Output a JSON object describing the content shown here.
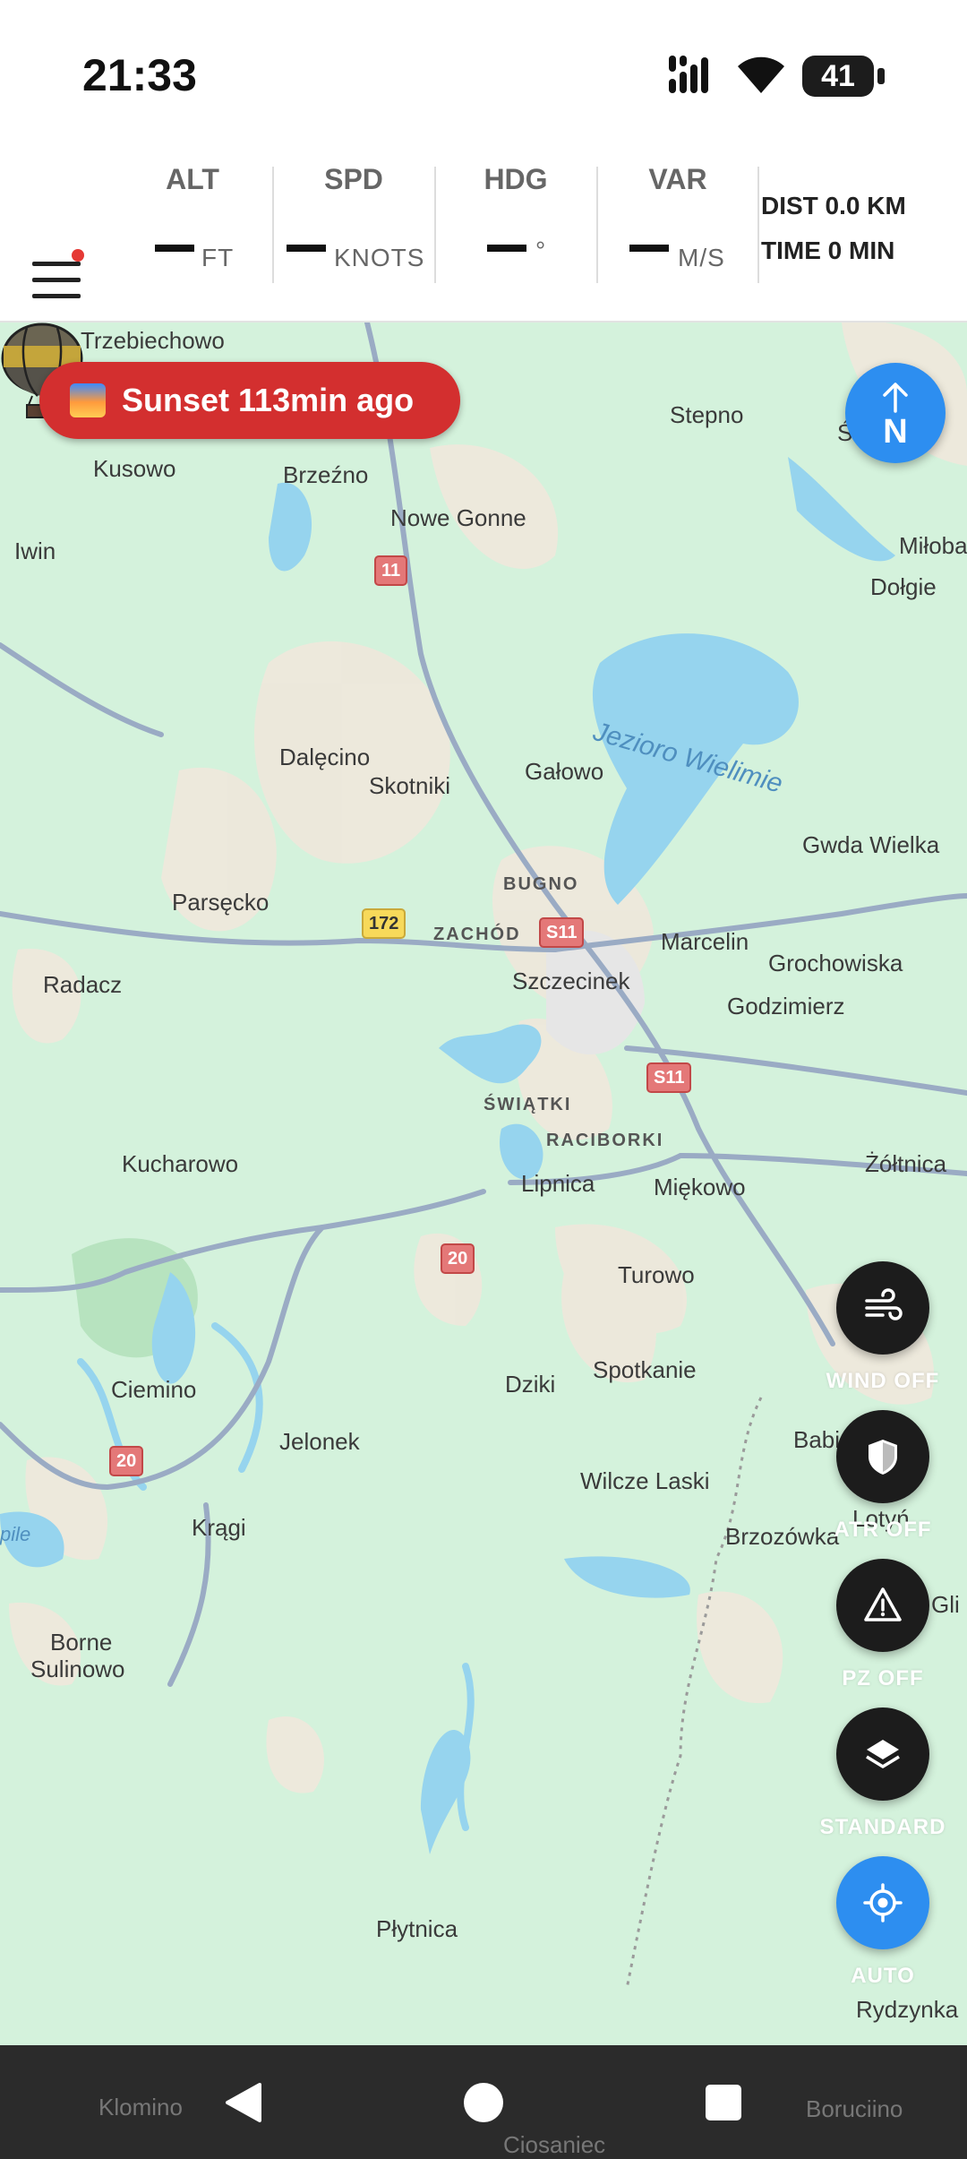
{
  "status_bar": {
    "time": "21:33",
    "battery": "41",
    "icons": [
      "signal-icon",
      "wifi-icon",
      "battery-icon"
    ]
  },
  "instruments": {
    "menu_icon": "hamburger-menu-icon",
    "gauges": [
      {
        "label": "ALT",
        "value": "—",
        "unit": "FT"
      },
      {
        "label": "SPD",
        "value": "—",
        "unit": "KNOTS"
      },
      {
        "label": "HDG",
        "value": "—",
        "unit": "°"
      },
      {
        "label": "VAR",
        "value": "—",
        "unit": "M/S"
      }
    ],
    "distance": "DIST 0.0 KM",
    "time": "TIME 0 MIN"
  },
  "sunset_badge": {
    "icon": "sunset-icon",
    "text": "Sunset 113min ago"
  },
  "compass": {
    "label": "N",
    "icon": "north-arrow-icon"
  },
  "map_controls": [
    {
      "icon": "wind-icon",
      "label": "WIND OFF"
    },
    {
      "icon": "shield-icon",
      "label": "ATR OFF"
    },
    {
      "icon": "warning-triangle-icon",
      "label": "PZ OFF"
    },
    {
      "icon": "layers-icon",
      "label": "STANDARD"
    },
    {
      "icon": "gps-locate-icon",
      "label": "AUTO"
    }
  ],
  "map": {
    "places": [
      "Trzebiechowo",
      "Stepno",
      "Świdrzec",
      "Kusowo",
      "Brzeźno",
      "Nowe Gonne",
      "Iwin",
      "Miłoba",
      "Dołgie",
      "Jezioro Wielimie",
      "Dalęcino",
      "Gałowo",
      "Skotniki",
      "Gwda Wielka",
      "BUGNO",
      "Parsęcko",
      "ZACHÓD",
      "Marcelin",
      "Grochowiska",
      "Radacz",
      "Szczecinek",
      "Godzimierz",
      "ŚWIĄTKI",
      "RACIBORKI",
      "Żółtnica",
      "Kucharowo",
      "Lipnica",
      "Miękowo",
      "Turowo",
      "Dziki",
      "Spotkanie",
      "Ciemino",
      "Jelonek",
      "Babi Dół",
      "Wilcze Laski",
      "Lotyń",
      "Krągi",
      "Brzozówka",
      "Gli",
      "Borne",
      "Sulinowo",
      "Płytnica",
      "Rydzynka",
      "Klomino",
      "Boruciino",
      "Ciosaniec",
      "pile"
    ],
    "road_shields": [
      "11",
      "172",
      "S11",
      "S11",
      "20",
      "20",
      "20"
    ],
    "colors": {
      "land": "#d4f2dc",
      "water": "#96d4ee",
      "road": "#8fa2bd",
      "urban": "#efe8db"
    }
  },
  "nav_bar": {
    "icons": [
      "back-icon",
      "home-icon",
      "recents-icon"
    ]
  }
}
